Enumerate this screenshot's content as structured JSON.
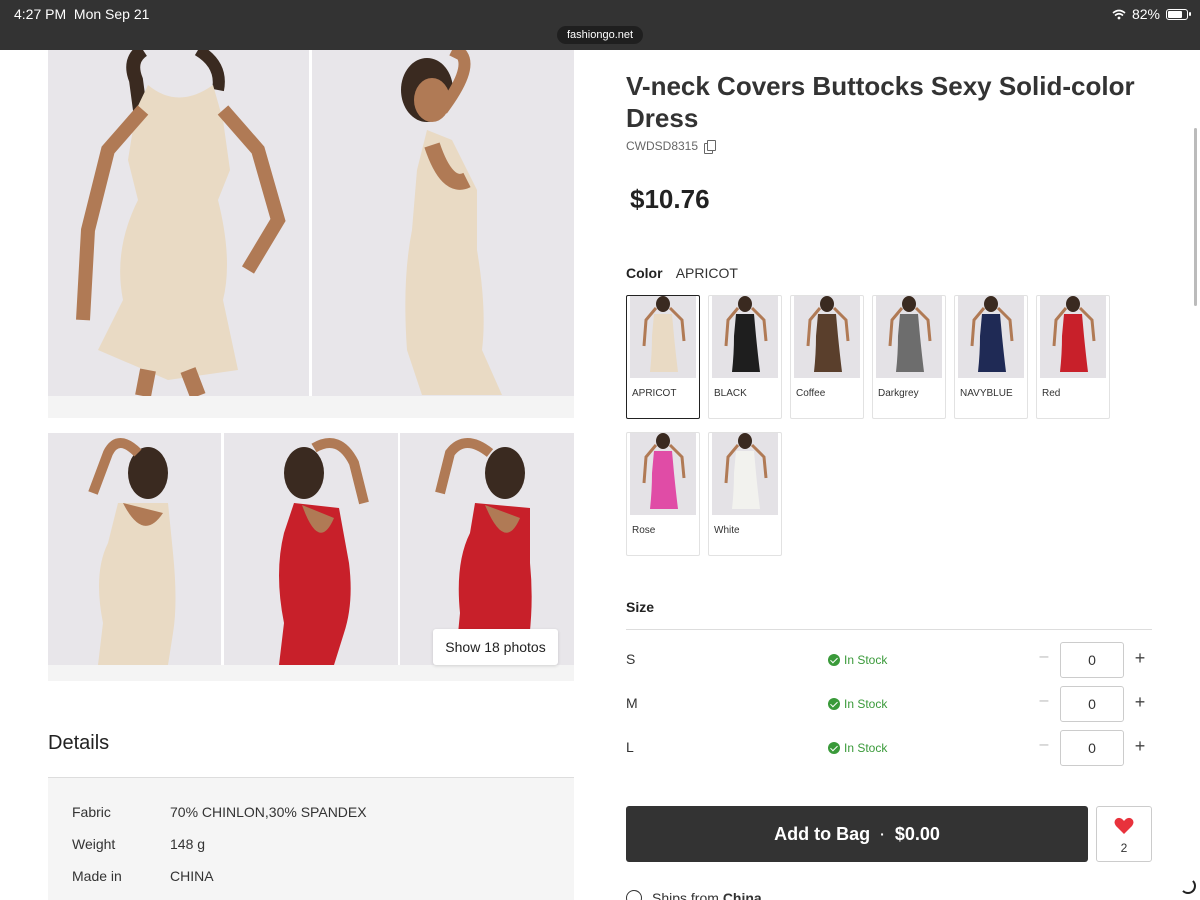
{
  "status_bar": {
    "time": "4:27 PM",
    "date": "Mon Sep 21",
    "battery": "82%",
    "battery_level": 0.82,
    "url": "fashiongo.net"
  },
  "gallery": {
    "show_photos_label": "Show 18 photos"
  },
  "product": {
    "title": "V-neck Covers Buttocks Sexy Solid-color Dress",
    "sku": "CWDSD8315",
    "price": "$10.76"
  },
  "color": {
    "label": "Color",
    "selected": "APRICOT",
    "options": [
      {
        "name": "APRICOT",
        "hex": "#e9dac4"
      },
      {
        "name": "BLACK",
        "hex": "#1e1e1e"
      },
      {
        "name": "Coffee",
        "hex": "#5a3f2c"
      },
      {
        "name": "Darkgrey",
        "hex": "#6d6d6d"
      },
      {
        "name": "NAVYBLUE",
        "hex": "#1f2a55"
      },
      {
        "name": "Red",
        "hex": "#c8202a"
      },
      {
        "name": "Rose",
        "hex": "#e04ca6"
      },
      {
        "name": "White",
        "hex": "#f2f2ee"
      }
    ]
  },
  "size": {
    "label": "Size",
    "rows": [
      {
        "name": "S",
        "stock": "In Stock",
        "qty": "0"
      },
      {
        "name": "M",
        "stock": "In Stock",
        "qty": "0"
      },
      {
        "name": "L",
        "stock": "In Stock",
        "qty": "0"
      }
    ]
  },
  "cart": {
    "add_label": "Add to Bag",
    "separator": "·",
    "total": "$0.00",
    "wish_count": "2"
  },
  "details": {
    "title": "Details",
    "rows": [
      {
        "key": "Fabric",
        "value": "70% CHINLON,30% SPANDEX"
      },
      {
        "key": "Weight",
        "value": "148 g"
      },
      {
        "key": "Made in",
        "value": "CHINA"
      }
    ]
  },
  "ships": {
    "prefix": "Ships from",
    "origin": "China"
  },
  "colors": {
    "status_bar_bg": "#333333",
    "add_to_bag_bg": "#333333",
    "in_stock": "#3a9a3a",
    "heart": "#e8323c"
  }
}
